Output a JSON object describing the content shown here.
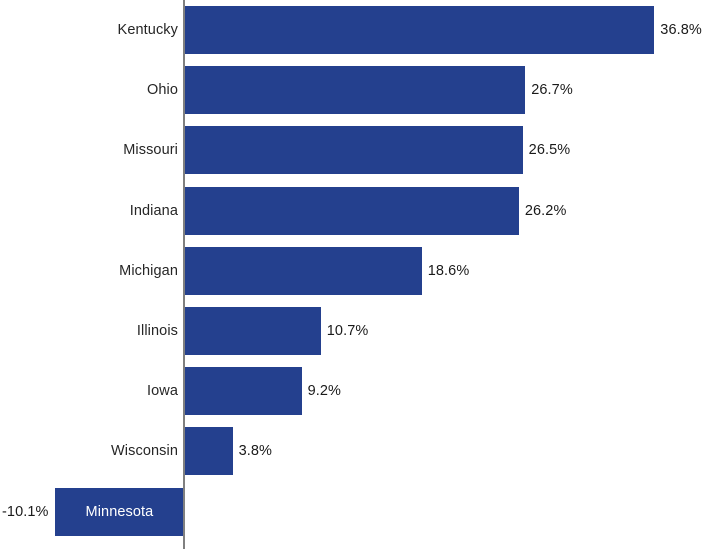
{
  "chart_data": {
    "type": "bar",
    "orientation": "horizontal",
    "title": "",
    "subtitle": "",
    "xlabel": "",
    "ylabel": "",
    "grid": false,
    "legend": false,
    "axis_zero_line": true,
    "value_suffix": "%",
    "categories": [
      "Kentucky",
      "Ohio",
      "Missouri",
      "Indiana",
      "Michigan",
      "Illinois",
      "Iowa",
      "Wisconsin",
      "Minnesota"
    ],
    "values": [
      36.8,
      26.7,
      26.5,
      26.2,
      18.6,
      10.7,
      9.2,
      3.8,
      -10.1
    ],
    "value_labels": [
      "36.8%",
      "26.7%",
      "26.5%",
      "26.2%",
      "18.6%",
      "10.7%",
      "9.2%",
      "3.8%",
      "-10.1%"
    ],
    "xlim": [
      -14.5,
      40.7
    ],
    "tick_labels": [],
    "series": [
      {
        "name": "",
        "color": "#24408E",
        "values": [
          36.8,
          26.7,
          26.5,
          26.2,
          18.6,
          10.7,
          9.2,
          3.8,
          -10.1
        ]
      }
    ],
    "bars": [
      {
        "category": "Kentucky",
        "value": 36.8,
        "value_label": "36.8%",
        "label_inside_bar": false,
        "negative": false
      },
      {
        "category": "Ohio",
        "value": 26.7,
        "value_label": "26.7%",
        "label_inside_bar": false,
        "negative": false
      },
      {
        "category": "Missouri",
        "value": 26.5,
        "value_label": "26.5%",
        "label_inside_bar": false,
        "negative": false
      },
      {
        "category": "Indiana",
        "value": 26.2,
        "value_label": "26.2%",
        "label_inside_bar": false,
        "negative": false
      },
      {
        "category": "Michigan",
        "value": 18.6,
        "value_label": "18.6%",
        "label_inside_bar": false,
        "negative": false
      },
      {
        "category": "Illinois",
        "value": 10.7,
        "value_label": "10.7%",
        "label_inside_bar": false,
        "negative": false
      },
      {
        "category": "Iowa",
        "value": 9.2,
        "value_label": "9.2%",
        "label_inside_bar": false,
        "negative": false
      },
      {
        "category": "Wisconsin",
        "value": 3.8,
        "value_label": "3.8%",
        "label_inside_bar": false,
        "negative": false
      },
      {
        "category": "Minnesota",
        "value": -10.1,
        "value_label": "-10.1%",
        "label_inside_bar": true,
        "negative": true
      }
    ]
  },
  "style": {
    "bar_color": "#24408E",
    "axis_color": "#808080",
    "text_color": "#262626",
    "value_text_color": "#1a1a1a",
    "inside_label_color": "#ffffff",
    "background": "#ffffff"
  }
}
